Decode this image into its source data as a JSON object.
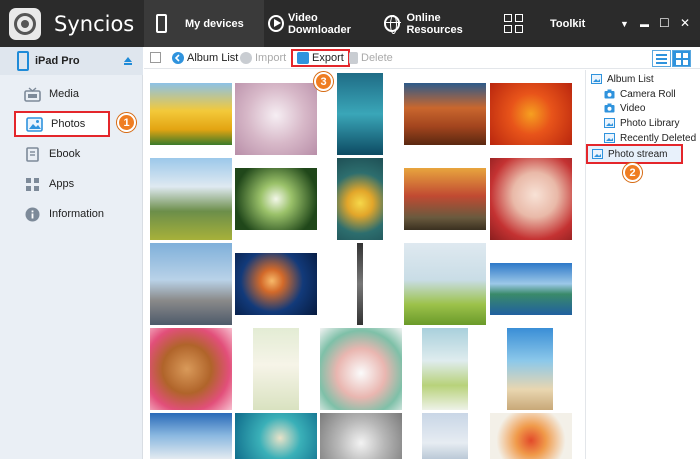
{
  "app": {
    "title": "Syncios"
  },
  "top_tabs": [
    {
      "label": "My devices",
      "active": true
    },
    {
      "label": "Video Downloader",
      "active": false
    },
    {
      "label": "Online Resources",
      "active": false
    },
    {
      "label": "Toolkit",
      "active": false
    }
  ],
  "window_controls": {
    "menu": "▼",
    "minimize": "▬",
    "maximize": "☐",
    "close": "✕"
  },
  "device": {
    "name": "iPad Pro"
  },
  "sidebar": {
    "items": [
      {
        "label": "Media",
        "icon": "tv-icon"
      },
      {
        "label": "Photos",
        "icon": "photo-icon",
        "selected": true
      },
      {
        "label": "Ebook",
        "icon": "book-icon"
      },
      {
        "label": "Apps",
        "icon": "apps-icon"
      },
      {
        "label": "Information",
        "icon": "info-icon"
      }
    ]
  },
  "toolbar": {
    "album_list": "Album List",
    "import": "Import",
    "export": "Export",
    "delete": "Delete"
  },
  "albums": {
    "root": "Album List",
    "children": [
      "Camera Roll",
      "Video",
      "Photo Library",
      "Recently Deleted"
    ],
    "stream": "Photo stream"
  },
  "badges": [
    "1",
    "2",
    "3"
  ],
  "colors": {
    "accent": "#2f93dd",
    "highlight": "#e4262b",
    "badge": "#ef7d22",
    "topbar": "#2b2b2b"
  }
}
